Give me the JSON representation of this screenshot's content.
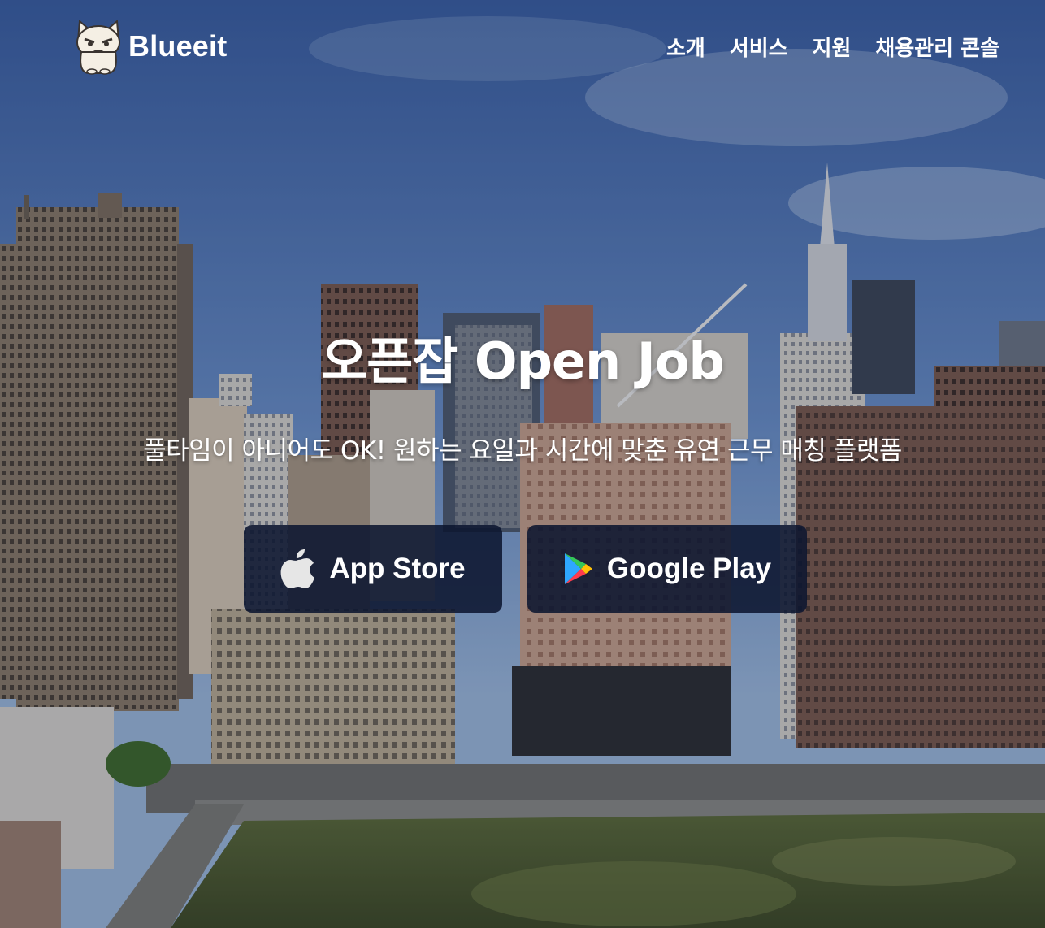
{
  "brand": {
    "name": "Blueeit"
  },
  "nav": {
    "items": [
      "소개",
      "서비스",
      "지원",
      "채용관리 콘솔"
    ]
  },
  "hero": {
    "title": "오픈잡 Open Job",
    "subtitle": "풀타임이 아니어도 OK! 원하는 요일과 시간에 맞춘 유연 근무 매칭 플랫폼"
  },
  "buttons": {
    "app_store": {
      "label": "App Store",
      "icon": "apple-icon"
    },
    "google_play": {
      "label": "Google Play",
      "icon": "google-play-icon"
    }
  },
  "colors": {
    "button_bg": "#0c1630",
    "sky_top": "#3e64a8",
    "sky_bottom": "#8fb0d6"
  }
}
